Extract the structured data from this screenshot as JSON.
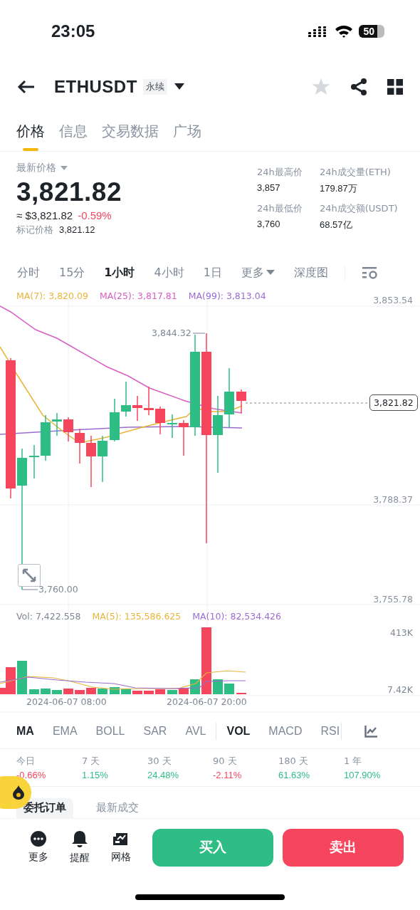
{
  "status_bar": {
    "time": "23:05",
    "battery": "50"
  },
  "header": {
    "symbol": "ETHUSDT",
    "contract_tag": "永续",
    "favorited": false
  },
  "tabs": [
    {
      "label": "价格",
      "selected": true
    },
    {
      "label": "信息",
      "selected": false
    },
    {
      "label": "交易数据",
      "selected": false
    },
    {
      "label": "广场",
      "selected": false
    }
  ],
  "price": {
    "label": "最新价格",
    "last": "3,821.82",
    "usd": "≈ $3,821.82",
    "change": "-0.59%",
    "negative": true,
    "mark_label": "标记价格",
    "mark": "3,821.12"
  },
  "stats": [
    {
      "label": "24h最高价",
      "value": "3,857"
    },
    {
      "label": "24h成交量(ETH)",
      "value": "179.87万"
    },
    {
      "label": "24h最低价",
      "value": "3,760"
    },
    {
      "label": "24h成交额(USDT)",
      "value": "68.57亿"
    }
  ],
  "intervals": [
    {
      "label": "分时",
      "selected": false,
      "kind": "plain"
    },
    {
      "label": "15分",
      "selected": false,
      "kind": "plain"
    },
    {
      "label": "1小时",
      "selected": true,
      "kind": "plain"
    },
    {
      "label": "4小时",
      "selected": false,
      "kind": "plain"
    },
    {
      "label": "1日",
      "selected": false,
      "kind": "plain"
    },
    {
      "label": "更多",
      "selected": false,
      "kind": "dropdown"
    },
    {
      "label": "深度图",
      "selected": false,
      "kind": "plain"
    }
  ],
  "chart": {
    "legend": [
      {
        "text": "MA(7): 3,820.09",
        "color": "#e8b43a"
      },
      {
        "text": "MA(25): 3,817.81",
        "color": "#d85fc4"
      },
      {
        "text": "MA(99): 3,813.04",
        "color": "#9a6cd0"
      }
    ],
    "y_labels": [
      "3,853.54",
      "3,788.37",
      "3,755.78"
    ],
    "high_label": "3,844.32",
    "low_label": "3,760.00",
    "last_price": "3,821.82"
  },
  "volume": {
    "legend": [
      {
        "text": "Vol: 7,422.558",
        "color": "#7d8794"
      },
      {
        "text": "MA(5): 135,586.625",
        "color": "#e8b43a"
      },
      {
        "text": "MA(10): 82,534.426",
        "color": "#9a6cd0"
      }
    ],
    "y_labels": [
      "413K",
      "7.42K"
    ],
    "x_labels": [
      "2024-06-07 08:00",
      "2024-06-07 20:00"
    ]
  },
  "indicators": [
    {
      "label": "MA",
      "selected": true
    },
    {
      "label": "EMA",
      "selected": false
    },
    {
      "label": "BOLL",
      "selected": false
    },
    {
      "label": "SAR",
      "selected": false
    },
    {
      "label": "AVL",
      "selected": false
    },
    {
      "label": "VOL",
      "selected": true
    },
    {
      "label": "MACD",
      "selected": false
    },
    {
      "label": "RSI",
      "selected": false
    }
  ],
  "performance": [
    {
      "period": "今日",
      "change": "-0.66%",
      "negative": true
    },
    {
      "period": "7 天",
      "change": "1.15%",
      "negative": false
    },
    {
      "period": "30 天",
      "change": "24.48%",
      "negative": false
    },
    {
      "period": "90 天",
      "change": "-2.11%",
      "negative": true
    },
    {
      "period": "180 天",
      "change": "61.63%",
      "negative": false
    },
    {
      "period": "1 年",
      "change": "107.90%",
      "negative": false
    }
  ],
  "order_tabs": [
    {
      "label": "委托订单",
      "selected": true
    },
    {
      "label": "最新成交",
      "selected": false
    }
  ],
  "bottom_nav": [
    {
      "label": "更多",
      "kind": "more"
    },
    {
      "label": "提醒",
      "kind": "alert"
    },
    {
      "label": "网格",
      "kind": "grid"
    }
  ],
  "actions": [
    {
      "label": "买入",
      "kind": "buy"
    },
    {
      "label": "卖出",
      "kind": "sell"
    }
  ]
}
